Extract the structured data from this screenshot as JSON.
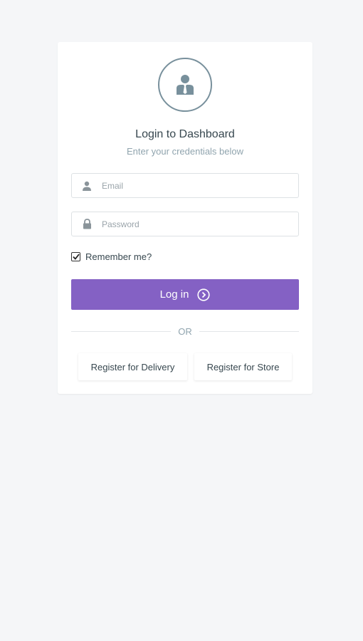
{
  "login": {
    "title": "Login to Dashboard",
    "subtitle": "Enter your credentials below",
    "email_placeholder": "Email",
    "email_value": "",
    "password_placeholder": "Password",
    "password_value": "",
    "remember_label": "Remember me?",
    "remember_checked": true,
    "login_label": "Log in",
    "divider_text": "OR",
    "register_delivery_label": "Register for Delivery",
    "register_store_label": "Register for Store"
  },
  "icons": {
    "avatar": "user-tie-icon",
    "email": "user-icon",
    "password": "lock-icon",
    "checkbox": "check-icon",
    "login_arrow": "chevron-right-circle-icon"
  },
  "colors": {
    "background": "#f5f6f8",
    "card": "#ffffff",
    "accent": "#8461c4",
    "icon": "#78909c",
    "text": "#37474f",
    "muted": "#90a4ae"
  }
}
